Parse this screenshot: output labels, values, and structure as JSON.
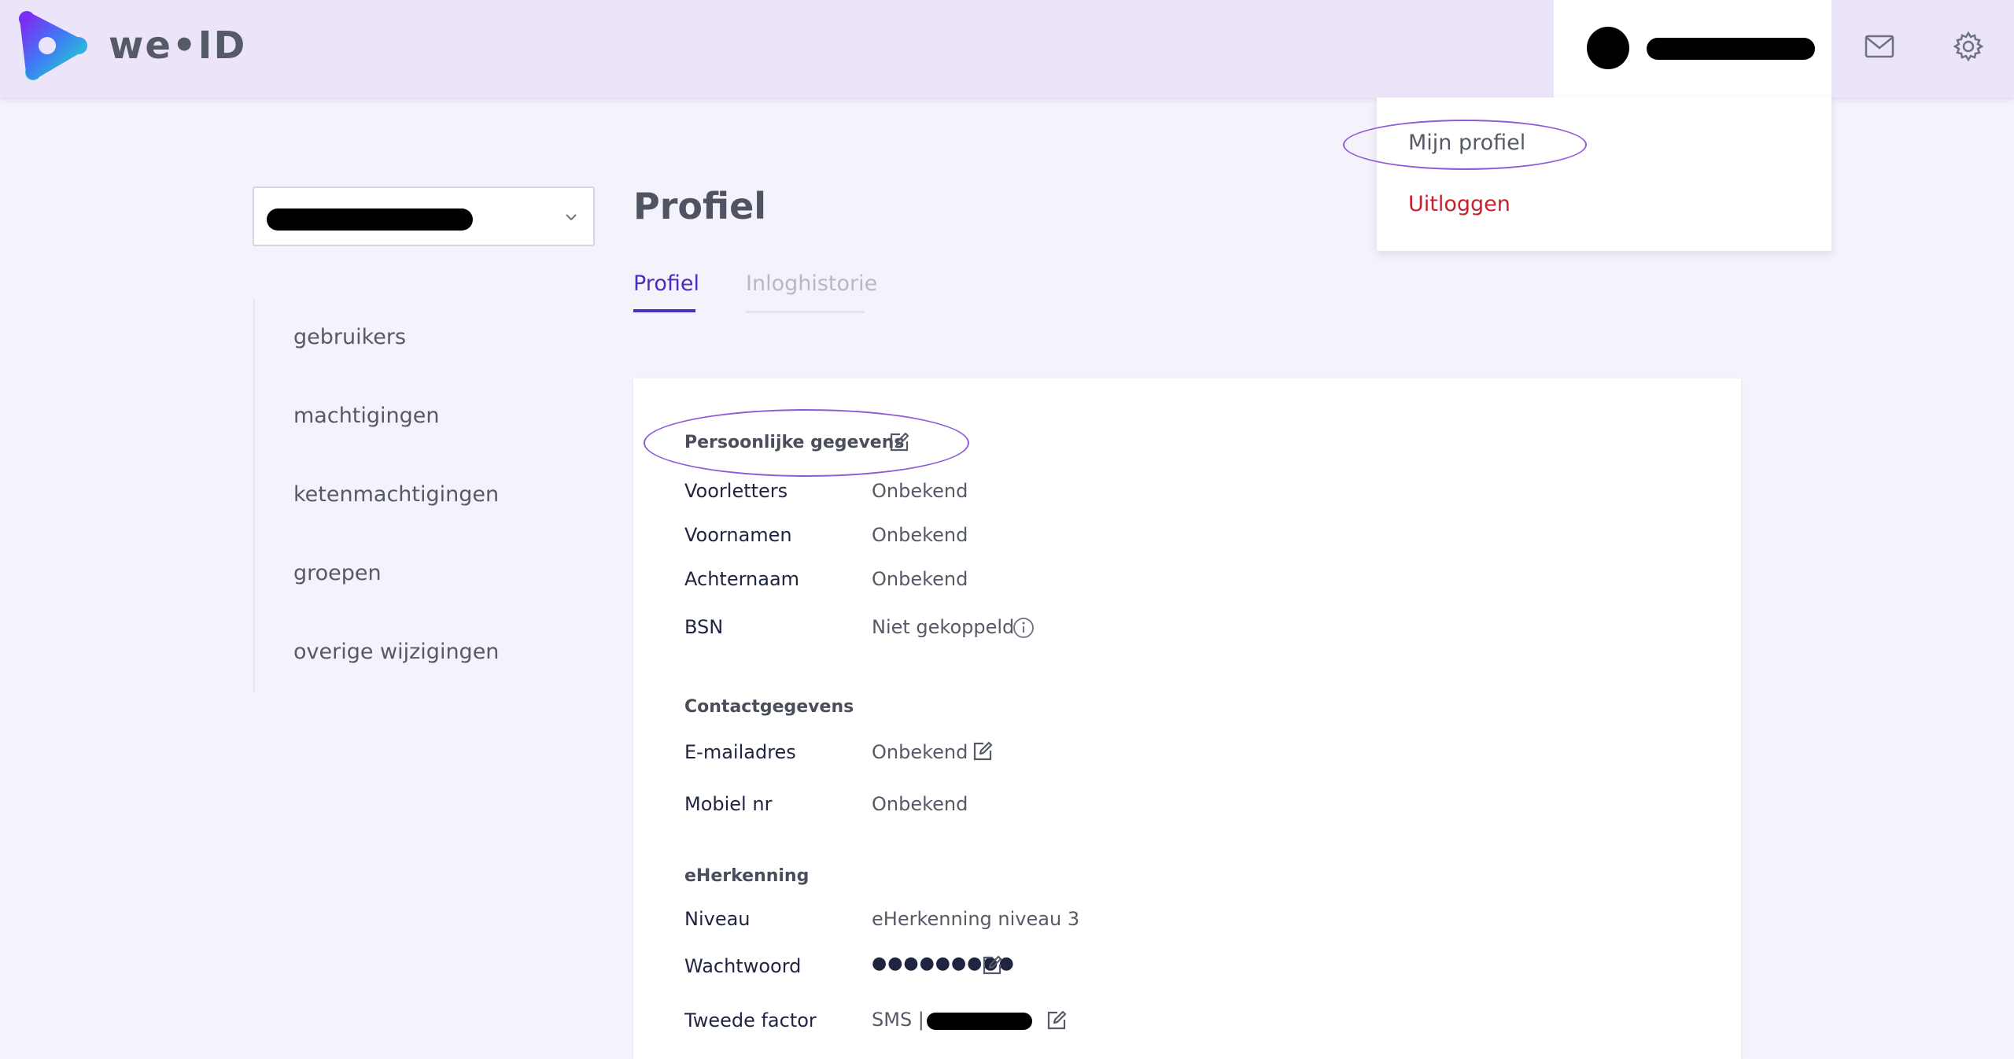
{
  "header": {
    "logo_text": "we•ID",
    "icons": {
      "mail": "mail-icon",
      "settings": "gear-icon"
    }
  },
  "user_menu": {
    "items": [
      {
        "label": "Mijn profiel"
      },
      {
        "label": "Uitloggen"
      }
    ]
  },
  "sidebar": {
    "items": [
      {
        "label": "gebruikers"
      },
      {
        "label": "machtigingen"
      },
      {
        "label": "ketenmachtigingen"
      },
      {
        "label": "groepen"
      },
      {
        "label": "overige wijzigingen"
      }
    ]
  },
  "page": {
    "title": "Profiel",
    "tabs": [
      {
        "label": "Profiel",
        "active": true
      },
      {
        "label": "Inloghistorie",
        "active": false
      }
    ]
  },
  "personal": {
    "title": "Persoonlijke gegevens",
    "fields": [
      {
        "label": "Voorletters",
        "value": "Onbekend"
      },
      {
        "label": "Voornamen",
        "value": "Onbekend"
      },
      {
        "label": "Achternaam",
        "value": "Onbekend"
      },
      {
        "label": "BSN",
        "value": "Niet gekoppeld"
      }
    ]
  },
  "contact": {
    "title": "Contactgegevens",
    "fields": [
      {
        "label": "E-mailadres",
        "value": "Onbekend"
      },
      {
        "label": "Mobiel nr",
        "value": "Onbekend"
      }
    ]
  },
  "eherkenning": {
    "title": "eHerkenning",
    "fields": [
      {
        "label": "Niveau",
        "value": "eHerkenning niveau 3"
      },
      {
        "label": "Wachtwoord",
        "value": "●●●●●●●●●"
      },
      {
        "label": "Tweede factor",
        "value": "SMS |"
      }
    ]
  },
  "colors": {
    "accent": "#4c2bbf",
    "logout": "#c8202d",
    "header_bg": "#ece5fa",
    "annotation": "#8e5ad8"
  }
}
